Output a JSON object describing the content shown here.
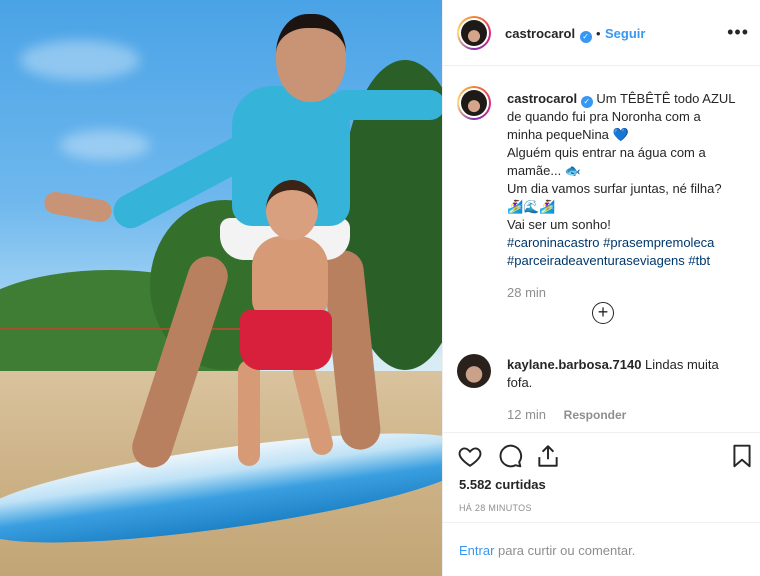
{
  "post": {
    "username": "castrocarol",
    "follow_label": "Seguir",
    "separator": "•",
    "more_options": "•••",
    "caption_lines": [
      "Um TÊBÊTÊ todo AZUL",
      "de quando fui pra Noronha com a",
      "minha pequeNina 💙",
      "Alguém quis entrar na água com a",
      "mamãe... 🐟",
      "Um dia vamos surfar juntas, né filha?",
      "🏄‍♀️🌊🏄‍♀️",
      "Vai ser um sonho!"
    ],
    "hashtags_line1": [
      "#caroninacastro",
      "#prasempremoleca"
    ],
    "hashtags_line2": [
      "#parceiradeaventuraseviagens",
      "#tbt"
    ],
    "caption_time": "28 min",
    "more_comments_icon": "plus-circle-icon"
  },
  "comment": {
    "username": "kaylane.barbosa.7140",
    "text": "Lindas muita fofa.",
    "time": "12 min",
    "reply_label": "Responder"
  },
  "actions": {
    "likes": "5.582 curtidas",
    "ago": "HÁ 28 MINUTOS"
  },
  "login": {
    "enter_label": "Entrar",
    "rest": " para curtir ou comentar."
  },
  "colors": {
    "accent": "#3897f0",
    "hashtag": "#00376b",
    "muted": "#8e8e8e",
    "surfboard": "#1e82c7",
    "rashguard": "#36b3d9",
    "kid_shorts": "#d8203c"
  }
}
